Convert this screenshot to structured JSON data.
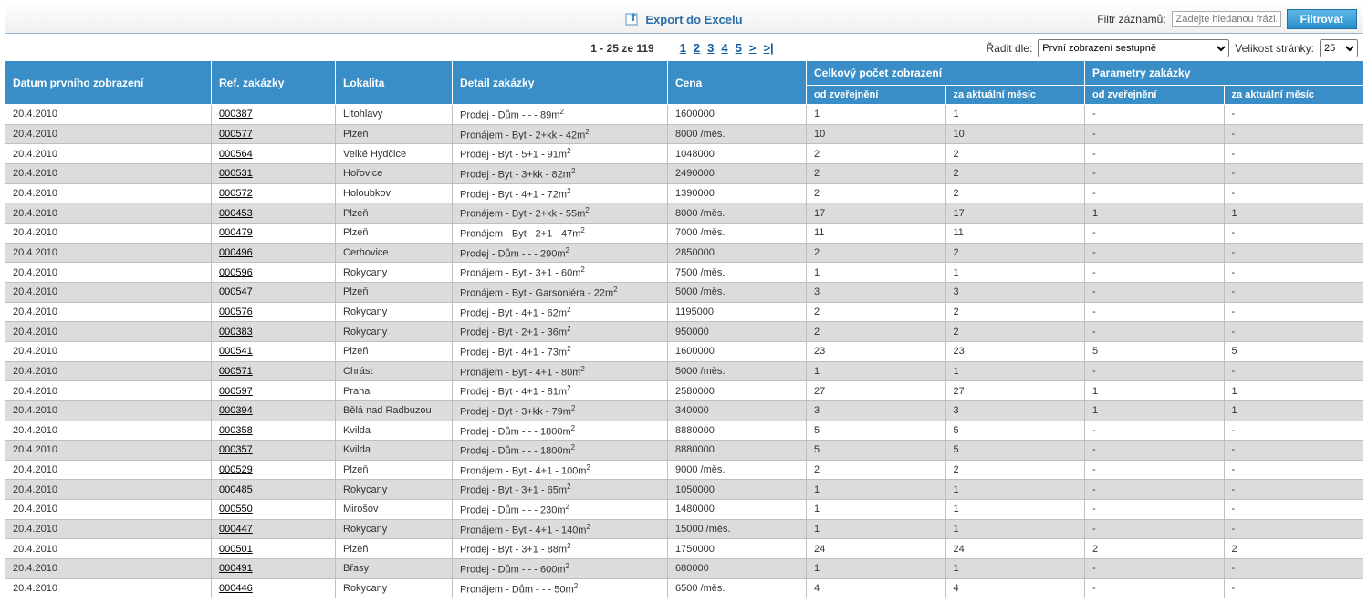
{
  "topbar": {
    "export_label": "Export do Excelu",
    "filter_label": "Filtr záznamů:",
    "filter_placeholder": "Zadejte hledanou frázi...",
    "filter_button": "Filtrovat"
  },
  "controls": {
    "page_info": "1 - 25 ze 119",
    "pages": [
      "1",
      "2",
      "3",
      "4",
      "5",
      ">",
      ">|"
    ],
    "sort_label": "Řadit dle:",
    "sort_selected": "První zobrazení sestupně",
    "pagesize_label": "Velikost stránky:",
    "pagesize_selected": "25"
  },
  "headers": {
    "datum": "Datum prvního zobrazení",
    "ref": "Ref. zakázky",
    "lokalita": "Lokalita",
    "detail": "Detail zakázky",
    "cena": "Cena",
    "celkovy": "Celkový počet zobrazení",
    "parametry": "Parametry zakázky",
    "od_zverejneni": "od zveřejnění",
    "za_aktual": "za aktuální měsíc"
  },
  "rows": [
    {
      "datum": "20.4.2010",
      "ref": "000387",
      "lokalita": "Litohlavy",
      "detail": "Prodej - Dům - - - 89m",
      "cena": "1600000",
      "c1": "1",
      "c2": "1",
      "p1": "-",
      "p2": "-"
    },
    {
      "datum": "20.4.2010",
      "ref": "000577",
      "lokalita": "Plzeň",
      "detail": "Pronájem - Byt - 2+kk - 42m",
      "cena": "8000   /měs.",
      "c1": "10",
      "c2": "10",
      "p1": "-",
      "p2": "-"
    },
    {
      "datum": "20.4.2010",
      "ref": "000564",
      "lokalita": "Velké Hydčice",
      "detail": "Prodej - Byt - 5+1 - 91m",
      "cena": "1048000",
      "c1": "2",
      "c2": "2",
      "p1": "-",
      "p2": "-"
    },
    {
      "datum": "20.4.2010",
      "ref": "000531",
      "lokalita": "Hořovice",
      "detail": "Prodej - Byt - 3+kk - 82m",
      "cena": "2490000",
      "c1": "2",
      "c2": "2",
      "p1": "-",
      "p2": "-"
    },
    {
      "datum": "20.4.2010",
      "ref": "000572",
      "lokalita": "Holoubkov",
      "detail": "Prodej - Byt - 4+1 - 72m",
      "cena": "1390000",
      "c1": "2",
      "c2": "2",
      "p1": "-",
      "p2": "-"
    },
    {
      "datum": "20.4.2010",
      "ref": "000453",
      "lokalita": "Plzeň",
      "detail": "Pronájem - Byt - 2+kk - 55m",
      "cena": "8000   /měs.",
      "c1": "17",
      "c2": "17",
      "p1": "1",
      "p2": "1"
    },
    {
      "datum": "20.4.2010",
      "ref": "000479",
      "lokalita": "Plzeň",
      "detail": "Pronájem - Byt - 2+1 - 47m",
      "cena": "7000   /měs.",
      "c1": "11",
      "c2": "11",
      "p1": "-",
      "p2": "-"
    },
    {
      "datum": "20.4.2010",
      "ref": "000496",
      "lokalita": "Cerhovice",
      "detail": "Prodej - Dům - - - 290m",
      "cena": "2850000",
      "c1": "2",
      "c2": "2",
      "p1": "-",
      "p2": "-"
    },
    {
      "datum": "20.4.2010",
      "ref": "000596",
      "lokalita": "Rokycany",
      "detail": "Pronájem - Byt - 3+1 - 60m",
      "cena": "7500   /měs.",
      "c1": "1",
      "c2": "1",
      "p1": "-",
      "p2": "-"
    },
    {
      "datum": "20.4.2010",
      "ref": "000547",
      "lokalita": "Plzeň",
      "detail": "Pronájem - Byt - Garsoniéra - 22m",
      "cena": "5000   /měs.",
      "c1": "3",
      "c2": "3",
      "p1": "-",
      "p2": "-"
    },
    {
      "datum": "20.4.2010",
      "ref": "000576",
      "lokalita": "Rokycany",
      "detail": "Prodej - Byt - 4+1 - 62m",
      "cena": "1195000",
      "c1": "2",
      "c2": "2",
      "p1": "-",
      "p2": "-"
    },
    {
      "datum": "20.4.2010",
      "ref": "000383",
      "lokalita": "Rokycany",
      "detail": "Prodej - Byt - 2+1 - 36m",
      "cena": "950000",
      "c1": "2",
      "c2": "2",
      "p1": "-",
      "p2": "-"
    },
    {
      "datum": "20.4.2010",
      "ref": "000541",
      "lokalita": "Plzeň",
      "detail": "Prodej - Byt - 4+1 - 73m",
      "cena": "1600000",
      "c1": "23",
      "c2": "23",
      "p1": "5",
      "p2": "5"
    },
    {
      "datum": "20.4.2010",
      "ref": "000571",
      "lokalita": "Chrást",
      "detail": "Pronájem - Byt - 4+1 - 80m",
      "cena": "5000   /měs.",
      "c1": "1",
      "c2": "1",
      "p1": "-",
      "p2": "-"
    },
    {
      "datum": "20.4.2010",
      "ref": "000597",
      "lokalita": "Praha",
      "detail": "Prodej - Byt - 4+1 - 81m",
      "cena": "2580000",
      "c1": "27",
      "c2": "27",
      "p1": "1",
      "p2": "1"
    },
    {
      "datum": "20.4.2010",
      "ref": "000394",
      "lokalita": "Bělá nad Radbuzou",
      "detail": "Prodej - Byt - 3+kk - 79m",
      "cena": "340000",
      "c1": "3",
      "c2": "3",
      "p1": "1",
      "p2": "1"
    },
    {
      "datum": "20.4.2010",
      "ref": "000358",
      "lokalita": "Kvilda",
      "detail": "Prodej - Dům - - - 1800m",
      "cena": "8880000",
      "c1": "5",
      "c2": "5",
      "p1": "-",
      "p2": "-"
    },
    {
      "datum": "20.4.2010",
      "ref": "000357",
      "lokalita": "Kvilda",
      "detail": "Prodej - Dům - - - 1800m",
      "cena": "8880000",
      "c1": "5",
      "c2": "5",
      "p1": "-",
      "p2": "-"
    },
    {
      "datum": "20.4.2010",
      "ref": "000529",
      "lokalita": "Plzeň",
      "detail": "Pronájem - Byt - 4+1 - 100m",
      "cena": "9000   /měs.",
      "c1": "2",
      "c2": "2",
      "p1": "-",
      "p2": "-"
    },
    {
      "datum": "20.4.2010",
      "ref": "000485",
      "lokalita": "Rokycany",
      "detail": "Prodej - Byt - 3+1 - 65m",
      "cena": "1050000",
      "c1": "1",
      "c2": "1",
      "p1": "-",
      "p2": "-"
    },
    {
      "datum": "20.4.2010",
      "ref": "000550",
      "lokalita": "Mirošov",
      "detail": "Prodej - Dům - - - 230m",
      "cena": "1480000",
      "c1": "1",
      "c2": "1",
      "p1": "-",
      "p2": "-"
    },
    {
      "datum": "20.4.2010",
      "ref": "000447",
      "lokalita": "Rokycany",
      "detail": "Pronájem - Byt - 4+1 - 140m",
      "cena": "15000   /měs.",
      "c1": "1",
      "c2": "1",
      "p1": "-",
      "p2": "-"
    },
    {
      "datum": "20.4.2010",
      "ref": "000501",
      "lokalita": "Plzeň",
      "detail": "Prodej - Byt - 3+1 - 88m",
      "cena": "1750000",
      "c1": "24",
      "c2": "24",
      "p1": "2",
      "p2": "2"
    },
    {
      "datum": "20.4.2010",
      "ref": "000491",
      "lokalita": "Břasy",
      "detail": "Prodej - Dům - - - 600m",
      "cena": "680000",
      "c1": "1",
      "c2": "1",
      "p1": "-",
      "p2": "-"
    },
    {
      "datum": "20.4.2010",
      "ref": "000446",
      "lokalita": "Rokycany",
      "detail": "Pronájem - Dům - - - 50m",
      "cena": "6500   /měs.",
      "c1": "4",
      "c2": "4",
      "p1": "-",
      "p2": "-"
    }
  ]
}
